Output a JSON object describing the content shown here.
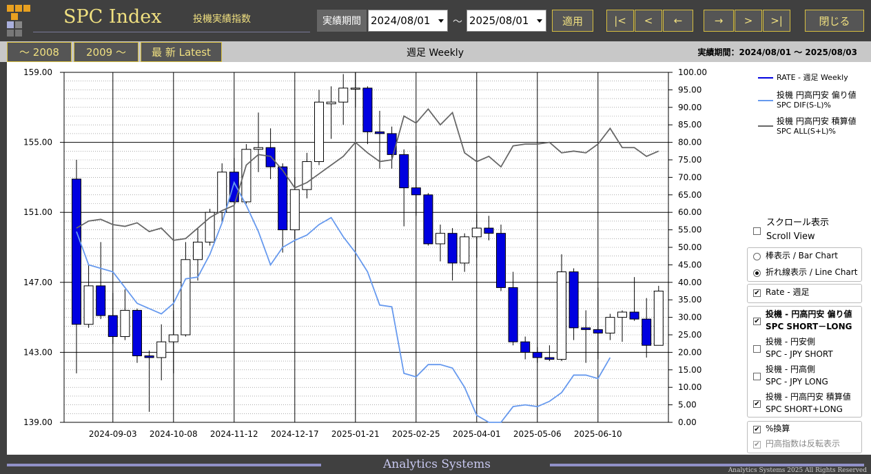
{
  "header": {
    "title": "SPC Index",
    "subtitle": "投機実績指数",
    "period_label": "実績期間",
    "date_from": "2024/08/01",
    "date_to": "2025/08/01",
    "tilde": "～",
    "apply_label": "適用",
    "nav": [
      "|<",
      "<",
      "←",
      "→",
      ">",
      ">|"
    ],
    "close_label": "閉じる"
  },
  "tabs": {
    "to2008": "～ 2008",
    "from2009": "2009 ～",
    "latest": "最 新  Latest",
    "chart_title": "週足 Weekly",
    "period_info": "実績期間：2024/08/01 ～ 2025/08/03"
  },
  "legend": {
    "rate": "RATE - 週足 Weekly",
    "dif_1": "投機 円高円安 偏り値",
    "dif_2": "SPC DIF(S-L)%",
    "all_1": "投機 円高円安 積算値",
    "all_2": "SPC ALL(S+L)%"
  },
  "panel": {
    "scroll_1": "スクロール表示",
    "scroll_2": "Scroll View",
    "bar_chart": "棒表示 / Bar Chart",
    "line_chart": "折れ線表示 / Line Chart",
    "rate_weekly": "Rate - 週足",
    "dif_1": "投機 - 円高円安 偏り値",
    "dif_2": "SPC  SHORT－LONG",
    "short_1": "投機 - 円安側",
    "short_2": "SPC - JPY SHORT",
    "long_1": "投機 - 円高側",
    "long_2": "SPC - JPY LONG",
    "sum_1": "投機 - 円高円安 積算値",
    "sum_2": "SPC  SHORT+LONG",
    "pct": "%換算",
    "invert": "円高指数は反転表示"
  },
  "footer": {
    "company": "Analytics Systems",
    "copyright": "Analytics Systems 2025 All Rights Reserved"
  },
  "colors": {
    "accent": "#f0e080",
    "bear": "#0000e0",
    "dif_line": "#6699ee",
    "all_line": "#666666"
  },
  "chart_data": {
    "type": "candlestick",
    "x_tick_labels": [
      "2024-09-03",
      "2024-10-08",
      "2024-11-12",
      "2024-12-17",
      "2025-01-21",
      "2025-02-25",
      "2025-04-01",
      "2025-05-06",
      "2025-06-10"
    ],
    "x_tick_index": [
      3,
      8,
      13,
      18,
      23,
      28,
      33,
      38,
      43
    ],
    "y_left_ticks": [
      "159.00",
      "155.00",
      "151.00",
      "147.00",
      "143.00",
      "139.00"
    ],
    "y_left_range": [
      139,
      159
    ],
    "y_right_ticks": [
      "100.00",
      "95.00",
      "90.00",
      "85.00",
      "80.00",
      "75.00",
      "70.00",
      "65.00",
      "60.00",
      "55.00",
      "50.00",
      "45.00",
      "40.00",
      "35.00",
      "30.00",
      "25.00",
      "20.00",
      "15.00",
      "10.00",
      "5.00",
      "0.00"
    ],
    "y_right_range": [
      0,
      100
    ],
    "grid": true,
    "candles": [
      [
        152.9,
        154.0,
        141.8,
        144.6
      ],
      [
        144.6,
        148.0,
        144.4,
        146.8
      ],
      [
        146.8,
        149.3,
        144.9,
        145.1
      ],
      [
        145.1,
        146.4,
        143.5,
        143.9
      ],
      [
        143.9,
        146.6,
        143.7,
        145.4
      ],
      [
        145.4,
        145.5,
        142.4,
        142.8
      ],
      [
        142.8,
        143.1,
        139.6,
        142.7
      ],
      [
        142.7,
        144.6,
        141.4,
        143.6
      ],
      [
        143.6,
        145.4,
        141.8,
        144.0
      ],
      [
        144.0,
        149.3,
        143.9,
        148.3
      ],
      [
        148.3,
        150.1,
        147.1,
        149.3
      ],
      [
        149.3,
        151.2,
        149.1,
        151.0
      ],
      [
        151.0,
        153.8,
        150.4,
        153.3
      ],
      [
        153.3,
        154.1,
        151.8,
        151.6
      ],
      [
        151.6,
        154.9,
        151.5,
        154.6
      ],
      [
        154.6,
        156.7,
        153.3,
        154.7
      ],
      [
        154.7,
        155.8,
        152.9,
        153.6
      ],
      [
        153.6,
        153.8,
        148.7,
        150.0
      ],
      [
        150.0,
        153.0,
        149.5,
        152.3
      ],
      [
        152.3,
        154.4,
        151.8,
        153.9
      ],
      [
        153.9,
        158.0,
        153.7,
        157.3
      ],
      [
        157.2,
        158.2,
        155.2,
        157.3
      ],
      [
        157.3,
        158.9,
        156.0,
        158.1
      ],
      [
        158.1,
        159.0,
        157.0,
        158.1
      ],
      [
        158.1,
        158.2,
        154.9,
        155.6
      ],
      [
        155.6,
        156.8,
        153.5,
        155.5
      ],
      [
        155.5,
        155.9,
        153.5,
        154.3
      ],
      [
        154.3,
        154.6,
        150.2,
        152.4
      ],
      [
        152.4,
        154.8,
        150.8,
        152.0
      ],
      [
        152.0,
        152.1,
        149.1,
        149.2
      ],
      [
        149.2,
        150.3,
        148.2,
        149.8
      ],
      [
        149.8,
        150.1,
        147.1,
        148.1
      ],
      [
        148.1,
        149.8,
        147.6,
        149.6
      ],
      [
        149.6,
        150.9,
        148.4,
        150.1
      ],
      [
        150.1,
        150.8,
        149.4,
        149.8
      ],
      [
        149.8,
        150.3,
        146.5,
        146.7
      ],
      [
        146.7,
        147.6,
        143.4,
        143.6
      ],
      [
        143.6,
        143.9,
        142.6,
        143.0
      ],
      [
        143.0,
        143.3,
        142.4,
        142.7
      ],
      [
        142.7,
        143.4,
        142.5,
        142.6
      ],
      [
        142.6,
        148.6,
        142.5,
        147.6
      ],
      [
        147.6,
        147.8,
        143.7,
        144.4
      ],
      [
        144.4,
        145.4,
        142.4,
        144.3
      ],
      [
        144.3,
        146.7,
        142.6,
        144.1
      ],
      [
        144.1,
        145.2,
        143.7,
        145.0
      ],
      [
        145.0,
        145.4,
        143.6,
        145.3
      ],
      [
        145.3,
        147.3,
        144.8,
        144.9
      ],
      [
        144.9,
        146.1,
        142.7,
        143.4
      ],
      [
        143.4,
        146.8,
        143.5,
        146.5
      ]
    ],
    "series": [
      {
        "name": "投機 円高円安 偏り値 SPC DIF(S-L)%",
        "axis": "right",
        "x_start": 0,
        "values": [
          54.5,
          45,
          44,
          43,
          38.5,
          34,
          32.5,
          31,
          34,
          41,
          41.5,
          48,
          57,
          68.5,
          62,
          54.5,
          45,
          50,
          52,
          53.5,
          56.5,
          58.5,
          53,
          48.5,
          43,
          33.5,
          33,
          14,
          13,
          16.5,
          16.5,
          15.5,
          10,
          2,
          0,
          0,
          4.5,
          5,
          4.5,
          6,
          8.5,
          13.5,
          13.5,
          12.5,
          18.5
        ]
      },
      {
        "name": "投機 円高円安 積算値 SPC ALL(S+L)%",
        "axis": "right",
        "x_start": 0,
        "values": [
          55.5,
          57.5,
          58,
          56.5,
          56,
          57,
          54.5,
          55.5,
          52,
          52.5,
          55.5,
          58.5,
          60.5,
          62,
          73.5,
          76.5,
          76,
          72,
          67,
          68.5,
          71,
          73.5,
          76,
          80,
          77,
          74.5,
          75,
          87.5,
          85.5,
          89.5,
          85,
          88.5,
          77,
          74.5,
          76,
          73,
          79,
          79.5,
          79.5,
          80,
          77,
          77.5,
          77,
          79.5,
          84,
          78.5,
          78.5,
          76,
          77.5
        ]
      }
    ]
  }
}
